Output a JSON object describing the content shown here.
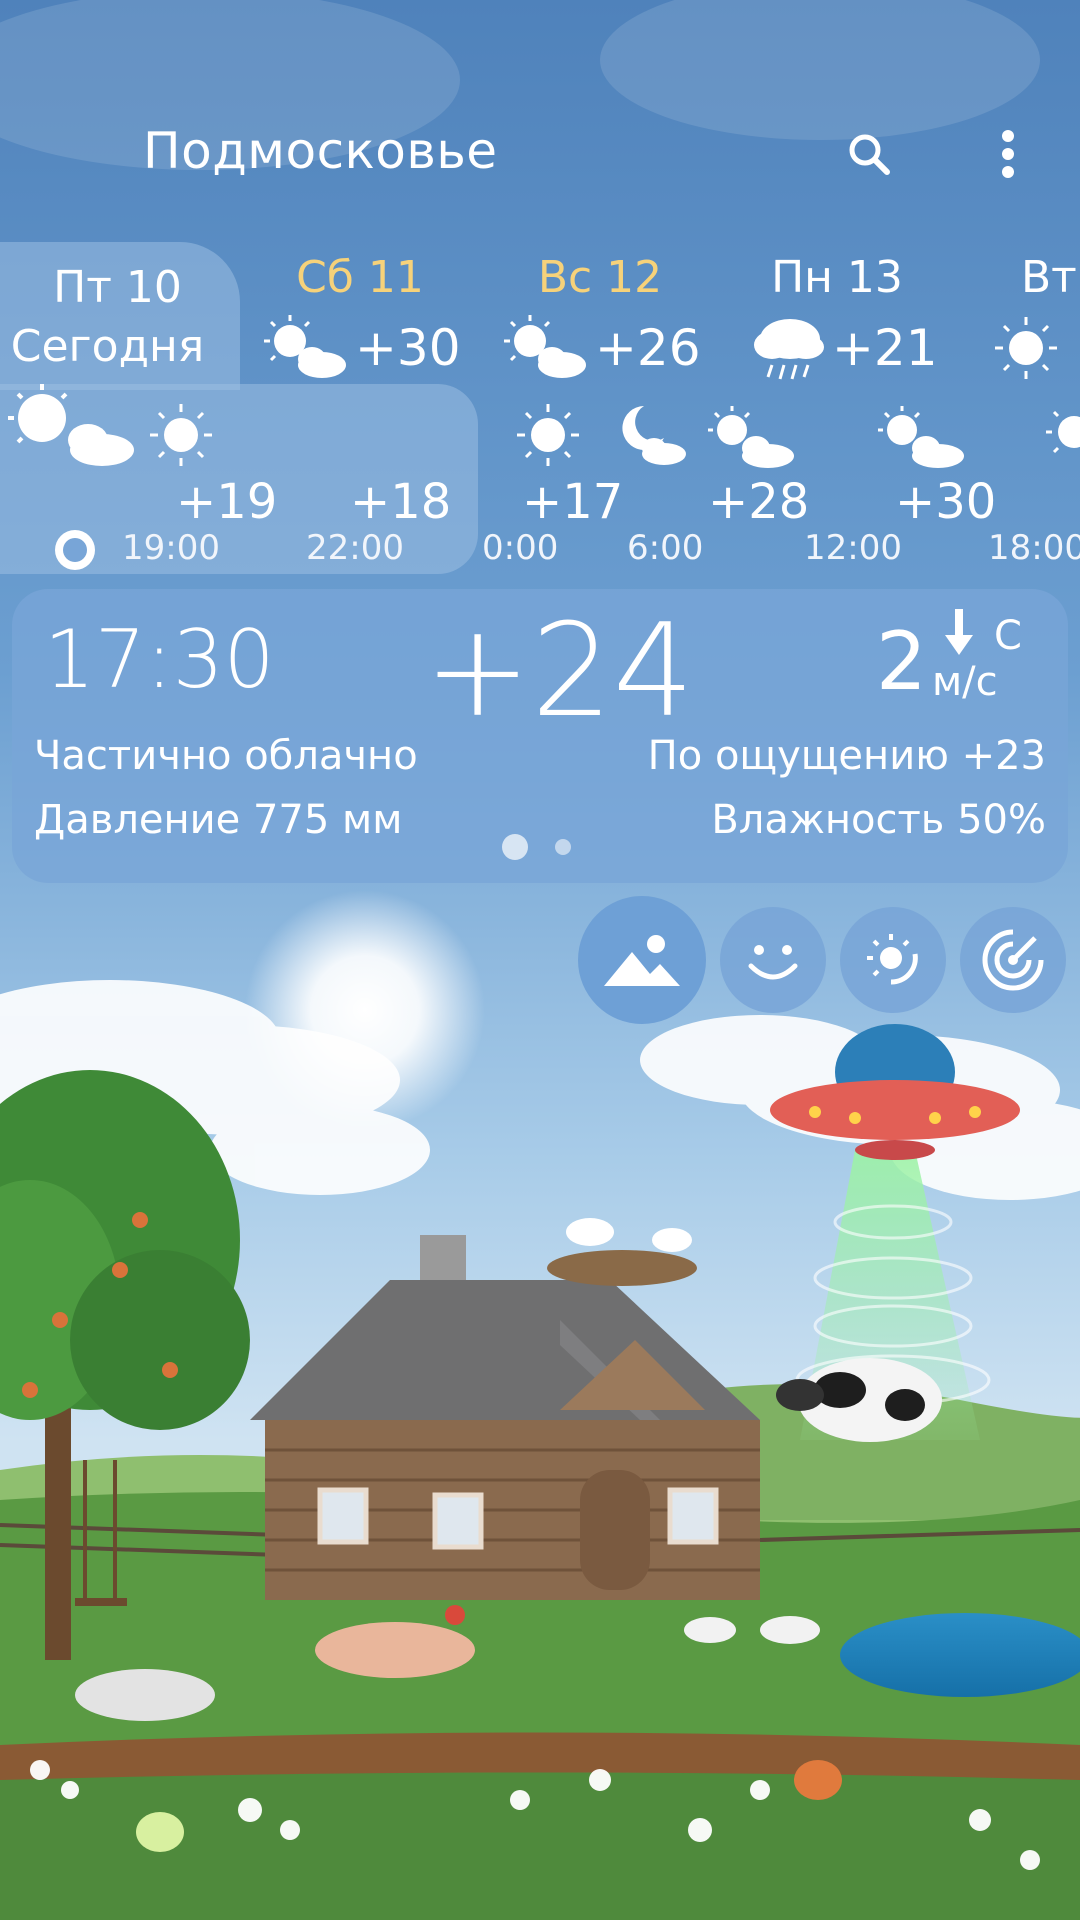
{
  "header": {
    "location": "Подмосковье",
    "search_icon": "search-icon",
    "menu_icon": "more-vert-icon"
  },
  "days": [
    {
      "label": "Пт 10",
      "sublabel": "Сегодня",
      "temp": "",
      "icon": "sun-cloud-icon",
      "selected": true,
      "color": "#ffffff"
    },
    {
      "label": "Сб 11",
      "temp": "+30",
      "icon": "sun-cloud-icon",
      "selected": false,
      "color": "#f6d27a"
    },
    {
      "label": "Вс 12",
      "temp": "+26",
      "icon": "sun-cloud-icon",
      "selected": false,
      "color": "#f6d27a"
    },
    {
      "label": "Пн 13",
      "temp": "+21",
      "icon": "rain-cloud-icon",
      "selected": false,
      "color": "#ffffff"
    },
    {
      "label": "Вт",
      "temp": "",
      "icon": "sun-icon",
      "selected": false,
      "color": "#ffffff"
    }
  ],
  "hours": [
    {
      "time": "19:00",
      "temp": "+19",
      "icon": "sun-icon"
    },
    {
      "time": "22:00",
      "temp": "+18",
      "icon": ""
    },
    {
      "time": "0:00",
      "temp": "+17",
      "icon": "sun-icon"
    },
    {
      "time": "6:00",
      "temp": "+28",
      "icon": "moon-cloud-icon"
    },
    {
      "time": "12:00",
      "temp": "+30",
      "icon": "sun-cloud-icon"
    },
    {
      "time": "18:00",
      "temp": "",
      "icon": "sun-cloud-icon"
    }
  ],
  "current": {
    "time": "17:30",
    "temp": "+24",
    "wind_speed": "2",
    "wind_dir": "С",
    "wind_unit": "м/с",
    "condition": "Частично облачно",
    "feels_like": "По ощущению +23",
    "pressure": "Давление 775 мм",
    "humidity": "Влажность 50%"
  },
  "page_indicator": {
    "count": 2,
    "active": 0
  },
  "modes": [
    {
      "name": "landscape-icon",
      "active": true
    },
    {
      "name": "smile-icon",
      "active": false
    },
    {
      "name": "sun-cycle-icon",
      "active": false
    },
    {
      "name": "radar-icon",
      "active": false
    }
  ],
  "colors": {
    "accent_yellow": "#f6d27a",
    "card_blue": "#78a5d7",
    "sky_top": "#5b8ec4",
    "grass": "#4f8a3c"
  }
}
